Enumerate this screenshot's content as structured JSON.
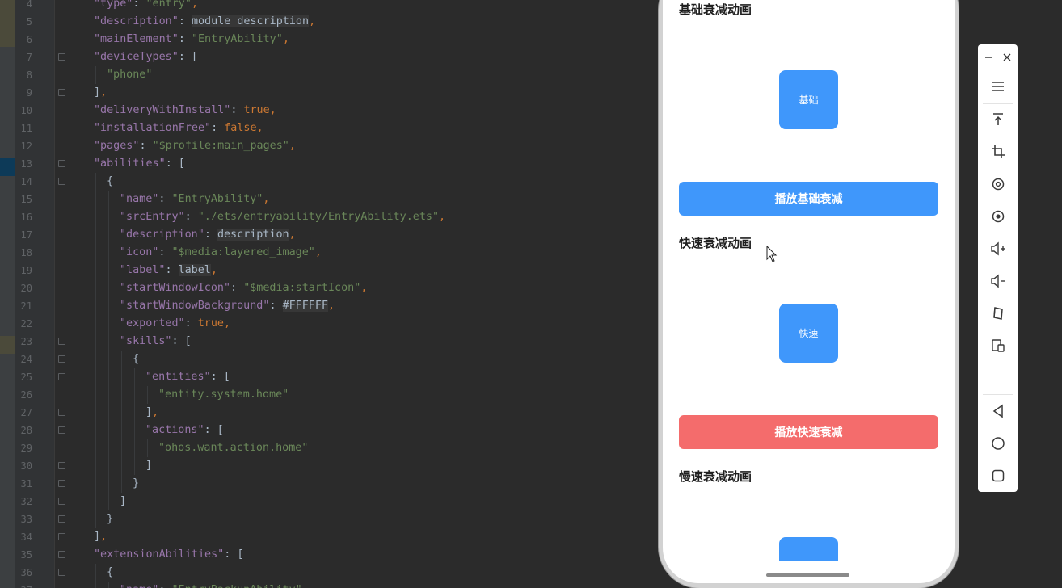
{
  "editor": {
    "lines": [
      {
        "n": "4",
        "indent": 0,
        "tokens": [
          [
            "k",
            "\"type\""
          ],
          [
            "p",
            ": "
          ],
          [
            "s",
            "\"entry\""
          ],
          [
            "b",
            ","
          ]
        ]
      },
      {
        "n": "5",
        "indent": 0,
        "tokens": [
          [
            "k",
            "\"description\""
          ],
          [
            "p",
            ": "
          ],
          [
            "r",
            "module description"
          ],
          [
            "b",
            ","
          ]
        ]
      },
      {
        "n": "6",
        "indent": 0,
        "tokens": [
          [
            "k",
            "\"mainElement\""
          ],
          [
            "p",
            ": "
          ],
          [
            "s",
            "\"EntryAbility\""
          ],
          [
            "b",
            ","
          ]
        ]
      },
      {
        "n": "7",
        "indent": 0,
        "fold": true,
        "tokens": [
          [
            "k",
            "\"deviceTypes\""
          ],
          [
            "p",
            ": ["
          ]
        ]
      },
      {
        "n": "8",
        "indent": 1,
        "tokens": [
          [
            "s",
            "\"phone\""
          ]
        ]
      },
      {
        "n": "9",
        "indent": 0,
        "fold": true,
        "tokens": [
          [
            "p",
            "]"
          ],
          [
            "b",
            ","
          ]
        ]
      },
      {
        "n": "10",
        "indent": 0,
        "tokens": [
          [
            "k",
            "\"deliveryWithInstall\""
          ],
          [
            "p",
            ": "
          ],
          [
            "b",
            "true,"
          ]
        ]
      },
      {
        "n": "11",
        "indent": 0,
        "tokens": [
          [
            "k",
            "\"installationFree\""
          ],
          [
            "p",
            ": "
          ],
          [
            "b",
            "false,"
          ]
        ]
      },
      {
        "n": "12",
        "indent": 0,
        "tokens": [
          [
            "k",
            "\"pages\""
          ],
          [
            "p",
            ": "
          ],
          [
            "s",
            "\"$profile:main_pages\""
          ],
          [
            "b",
            ","
          ]
        ]
      },
      {
        "n": "13",
        "indent": 0,
        "fold": true,
        "tokens": [
          [
            "k",
            "\"abilities\""
          ],
          [
            "p",
            ": ["
          ]
        ]
      },
      {
        "n": "14",
        "indent": 1,
        "fold": true,
        "tokens": [
          [
            "p",
            "{"
          ]
        ]
      },
      {
        "n": "15",
        "indent": 2,
        "tokens": [
          [
            "k",
            "\"name\""
          ],
          [
            "p",
            ": "
          ],
          [
            "s",
            "\"EntryAbility\""
          ],
          [
            "b",
            ","
          ]
        ]
      },
      {
        "n": "16",
        "indent": 2,
        "tokens": [
          [
            "k",
            "\"srcEntry\""
          ],
          [
            "p",
            ": "
          ],
          [
            "s",
            "\"./ets/entryability/EntryAbility.ets\""
          ],
          [
            "b",
            ","
          ]
        ]
      },
      {
        "n": "17",
        "indent": 2,
        "tokens": [
          [
            "k",
            "\"description\""
          ],
          [
            "p",
            ": "
          ],
          [
            "r",
            "description"
          ],
          [
            "b",
            ","
          ]
        ]
      },
      {
        "n": "18",
        "indent": 2,
        "tokens": [
          [
            "k",
            "\"icon\""
          ],
          [
            "p",
            ": "
          ],
          [
            "s",
            "\"$media:layered_image\""
          ],
          [
            "b",
            ","
          ]
        ]
      },
      {
        "n": "19",
        "indent": 2,
        "tokens": [
          [
            "k",
            "\"label\""
          ],
          [
            "p",
            ": "
          ],
          [
            "r",
            "label"
          ],
          [
            "b",
            ","
          ]
        ]
      },
      {
        "n": "20",
        "indent": 2,
        "tokens": [
          [
            "k",
            "\"startWindowIcon\""
          ],
          [
            "p",
            ": "
          ],
          [
            "s",
            "\"$media:startIcon\""
          ],
          [
            "b",
            ","
          ]
        ]
      },
      {
        "n": "21",
        "indent": 2,
        "tokens": [
          [
            "k",
            "\"startWindowBackground\""
          ],
          [
            "p",
            ": "
          ],
          [
            "r",
            "#FFFFFF"
          ],
          [
            "b",
            ","
          ]
        ]
      },
      {
        "n": "22",
        "indent": 2,
        "tokens": [
          [
            "k",
            "\"exported\""
          ],
          [
            "p",
            ": "
          ],
          [
            "b",
            "true,"
          ]
        ]
      },
      {
        "n": "23",
        "indent": 2,
        "fold": true,
        "tokens": [
          [
            "k",
            "\"skills\""
          ],
          [
            "p",
            ": ["
          ]
        ]
      },
      {
        "n": "24",
        "indent": 3,
        "fold": true,
        "tokens": [
          [
            "p",
            "{"
          ]
        ]
      },
      {
        "n": "25",
        "indent": 4,
        "fold": true,
        "tokens": [
          [
            "k",
            "\"entities\""
          ],
          [
            "p",
            ": ["
          ]
        ]
      },
      {
        "n": "26",
        "indent": 5,
        "tokens": [
          [
            "s",
            "\"entity.system.home\""
          ]
        ]
      },
      {
        "n": "27",
        "indent": 4,
        "fold": true,
        "tokens": [
          [
            "p",
            "]"
          ],
          [
            "b",
            ","
          ]
        ]
      },
      {
        "n": "28",
        "indent": 4,
        "fold": true,
        "tokens": [
          [
            "k",
            "\"actions\""
          ],
          [
            "p",
            ": ["
          ]
        ]
      },
      {
        "n": "29",
        "indent": 5,
        "tokens": [
          [
            "s",
            "\"ohos.want.action.home\""
          ]
        ]
      },
      {
        "n": "30",
        "indent": 4,
        "fold": true,
        "tokens": [
          [
            "p",
            "]"
          ]
        ]
      },
      {
        "n": "31",
        "indent": 3,
        "fold": true,
        "tokens": [
          [
            "p",
            "}"
          ]
        ]
      },
      {
        "n": "32",
        "indent": 2,
        "fold": true,
        "tokens": [
          [
            "p",
            "]"
          ]
        ]
      },
      {
        "n": "33",
        "indent": 1,
        "fold": true,
        "tokens": [
          [
            "p",
            "}"
          ]
        ]
      },
      {
        "n": "34",
        "indent": 0,
        "fold": true,
        "tokens": [
          [
            "p",
            "]"
          ],
          [
            "b",
            ","
          ]
        ]
      },
      {
        "n": "35",
        "indent": 0,
        "fold": true,
        "tokens": [
          [
            "k",
            "\"extensionAbilities\""
          ],
          [
            "p",
            ": ["
          ]
        ]
      },
      {
        "n": "36",
        "indent": 1,
        "fold": true,
        "tokens": [
          [
            "p",
            "{"
          ]
        ]
      },
      {
        "n": "37",
        "indent": 2,
        "tokens": [
          [
            "k",
            "\"name\""
          ],
          [
            "p",
            ": "
          ],
          [
            "s",
            "\"EntryBackupAbility\""
          ],
          [
            "b",
            ","
          ]
        ]
      }
    ]
  },
  "phone": {
    "section_basic_title": "基础衰减动画",
    "box_basic_label": "基础",
    "button_basic_label": "播放基础衰减",
    "section_fast_title": "快速衰减动画",
    "box_fast_label": "快速",
    "button_fast_label": "播放快速衰减",
    "section_slow_title": "慢速衰减动画",
    "colors": {
      "primary": "#3f97fb",
      "danger": "#f46c6c"
    }
  },
  "toolbar": {
    "icons": [
      "upload-top-icon",
      "crop-icon",
      "rotate-icon",
      "screenshot-icon",
      "volume-up-icon",
      "volume-down-icon",
      "fold-icon",
      "multi-device-icon",
      "back-icon",
      "home-icon",
      "recent-apps-icon"
    ]
  }
}
